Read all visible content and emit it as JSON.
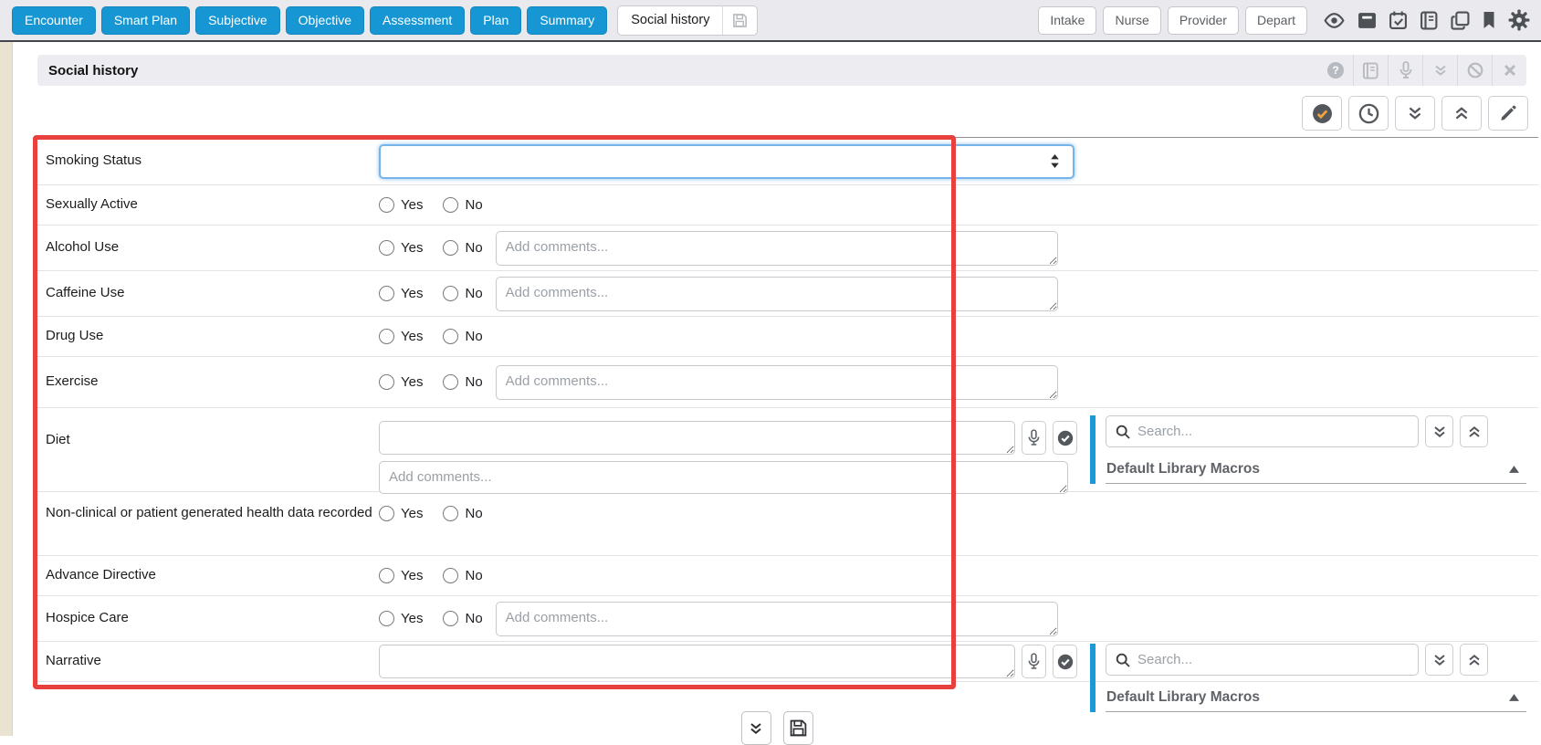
{
  "topbar": {
    "nav": [
      "Encounter",
      "Smart Plan",
      "Subjective",
      "Objective",
      "Assessment",
      "Plan",
      "Summary"
    ],
    "active_tab": "Social history",
    "stages": [
      "Intake",
      "Nurse",
      "Provider",
      "Depart"
    ]
  },
  "section": {
    "title": "Social history"
  },
  "form": {
    "yes": "Yes",
    "no": "No",
    "comments_placeholder": "Add comments...",
    "rows": {
      "smoking": "Smoking Status",
      "sexually_active": "Sexually Active",
      "alcohol": "Alcohol Use",
      "caffeine": "Caffeine Use",
      "drug": "Drug Use",
      "exercise": "Exercise",
      "diet": "Diet",
      "nonclinical": "Non-clinical or patient generated health data recorded",
      "advance_directive": "Advance Directive",
      "hospice": "Hospice Care",
      "narrative": "Narrative"
    }
  },
  "macro_panel": {
    "search_placeholder": "Search...",
    "title": "Default Library Macros"
  },
  "colors": {
    "accent_blue": "#1697d4",
    "panel_bar_blue": "#1a9bd7",
    "annotation_red": "#e8403c"
  }
}
